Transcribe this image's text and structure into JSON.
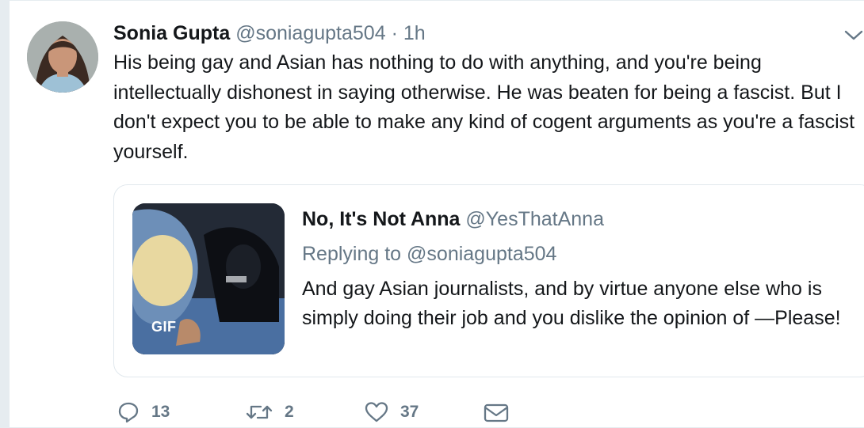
{
  "tweet": {
    "author_name": "Sonia Gupta",
    "handle": "@soniagupta504",
    "separator": "·",
    "time": "1h",
    "text": "His being gay and Asian has nothing to do with anything, and you're being intellectually dishonest in saying otherwise. He was beaten for being a fascist. But I don't expect you to be able to make any kind of cogent arguments as you're a fascist yourself."
  },
  "quoted_tweet": {
    "author_name": "No, It's Not Anna",
    "handle": "@YesThatAnna",
    "replying_label": "Replying to",
    "replying_to": "@soniagupta504",
    "text": "And gay Asian journalists, and by virtue anyone else who is simply doing their job and you dislike the opinion of —Please!",
    "media_badge": "GIF"
  },
  "actions": {
    "reply_count": "13",
    "retweet_count": "2",
    "like_count": "37"
  },
  "icons": {
    "menu": "chevron-down-icon",
    "reply": "reply-icon",
    "retweet": "retweet-icon",
    "like": "heart-icon",
    "dm": "envelope-icon"
  },
  "colors": {
    "text_primary": "#14171a",
    "text_secondary": "#657786",
    "border": "#e1e8ed",
    "background": "#e6ecf0"
  }
}
